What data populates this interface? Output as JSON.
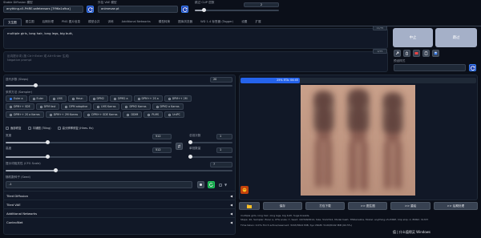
{
  "header": {
    "checkpoint_label": "Stable Diffusion 模型",
    "checkpoint_value": "anything-v5-PrtRE.safetensors [7f96a1a9ca]",
    "vae_label": "外挂 VAE 模型",
    "vae_value": "animevae.pt",
    "clip_label": "跳过 CLIP 层数",
    "clip_value": "2"
  },
  "tabs": [
    "文生图",
    "图生图",
    "后期处理",
    "PNG 图片信息",
    "模型合并",
    "训练",
    "Additional Networks",
    "模型转换",
    "图库浏览器",
    "WD 1.4 标签器 (Tagger)",
    "设置",
    "扩展"
  ],
  "prompt": {
    "positive": "multiple girls, long hair, long legs, big butt,",
    "positive_counter": "11/75",
    "negative_placeholder": "反向提示词 (按 Ctrl+Enter 或 Alt+Enter 生成)\nNegative prompt",
    "negative_counter": "0/75"
  },
  "actions": {
    "interrupt": "中止",
    "skip": "跳过",
    "style_label": "预设样式"
  },
  "sampling": {
    "steps_label": "迭代步数 (Steps)",
    "steps_value": "20",
    "steps_fraction": 0.13,
    "method_label": "采样方法 (Sampler)",
    "methods": [
      "Euler a",
      "Euler",
      "LMS",
      "Heun",
      "DPM2",
      "DPM2 a",
      "DPM++ 2S a",
      "DPM++ 2M",
      "DPM++ SDE",
      "DPM fast",
      "DPM adaptive",
      "LMS Karras",
      "DPM2 Karras",
      "DPM2 a Karras",
      "DPM++ 2S a Karras",
      "DPM++ 2M Karras",
      "DPM++ SDE Karras",
      "DDIM",
      "PLMS",
      "UniPC"
    ],
    "selected": "Euler a"
  },
  "options": {
    "restore_faces": "面部修复",
    "tiling": "平铺图 (Tiling)",
    "hires_fix": "高分辨率修复 (Hires. fix)"
  },
  "size": {
    "width_label": "宽度",
    "width_value": "512",
    "width_fraction": 0.25,
    "height_label": "高度",
    "height_value": "512",
    "height_fraction": 0.25,
    "batch_count_label": "总批次数",
    "batch_count_value": "1",
    "batch_size_label": "单批数量",
    "batch_size_value": "1"
  },
  "cfg": {
    "label": "提示词相关性 (CFG Scale)",
    "value": "7",
    "fraction": 0.22
  },
  "seed": {
    "label": "随机数种子 (Seed)",
    "value": "-1",
    "extra_label": ""
  },
  "accordions": [
    "Tiled Diffusion",
    "Tiled VAE",
    "Additional Networks",
    "ControlNet"
  ],
  "progress": {
    "text": "25% ETA: 04:45",
    "fraction": 0.25
  },
  "output": {
    "buttons": [
      "保存",
      "打包下载",
      ">> 图生图",
      ">> 重绘",
      ">> 后期处理"
    ],
    "info_line1": "multiple girls, long hair, long legs, big butt, huge breasts,",
    "info_line2": "Steps: 20, Sampler: Euler a, CFG scale: 7, Seed: 1674993614, Size: 512x512, Model hash: 7f96a1a9ca, Model: anything-v5-PrtRE, Clip skip: 2, ENSD: 31337",
    "info_line3": "Time taken: 0.07s  Torch active/reserved: 3163/3644 MiB, Sys VRAM: 5120/8192 MiB (62.5%)",
    "watermark": "值 | 什么值得买 Windows"
  },
  "colors": {
    "bg": "#0b0f19",
    "panel": "#111827",
    "accent": "#2563eb",
    "generate_btn": "#a5b0c8"
  }
}
